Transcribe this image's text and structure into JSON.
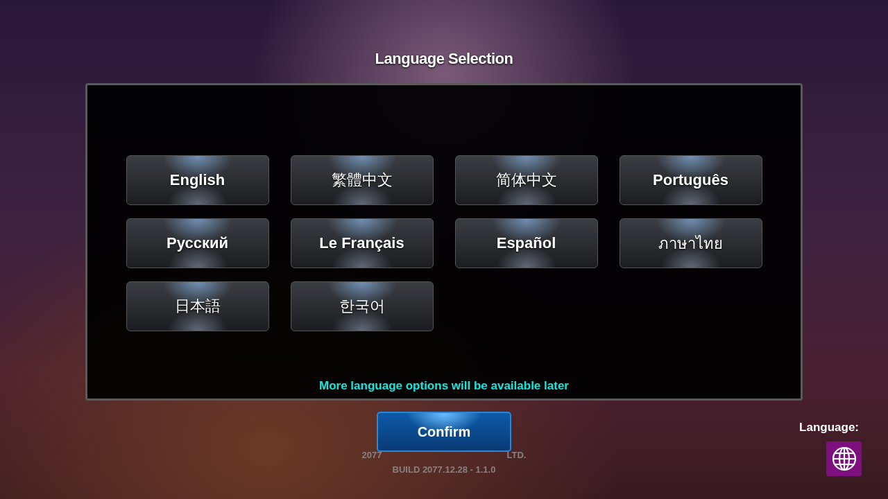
{
  "dialog": {
    "title": "Language Selection",
    "languages": [
      {
        "label": "English",
        "bold": true
      },
      {
        "label": "繁體中文",
        "bold": false
      },
      {
        "label": "简体中文",
        "bold": false
      },
      {
        "label": "Português",
        "bold": true
      },
      {
        "label": "Русский",
        "bold": true
      },
      {
        "label": "Le Français",
        "bold": true
      },
      {
        "label": "Español",
        "bold": true
      },
      {
        "label": "ภาษาไทย",
        "bold": false
      },
      {
        "label": "日本語",
        "bold": false
      },
      {
        "label": "한국어",
        "bold": false
      }
    ],
    "note": "More language options will be available later"
  },
  "confirm_button": "Confirm",
  "copyright": {
    "start": "2077",
    "end": "LTD."
  },
  "build": "BUILD 2077.12.28 - 1.1.0",
  "language_switch": {
    "label": "Language:"
  }
}
